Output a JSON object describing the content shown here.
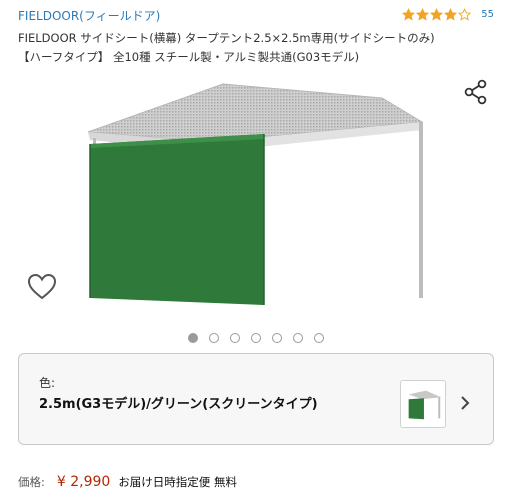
{
  "product": {
    "brand": "FIELDOOR(フィールドア)",
    "rating_stars": 4,
    "rating_count": "55",
    "title_line1": "FIELDOOR サイドシート(横幕) タープテント2.5×2.5m専用(サイドシートのみ)",
    "title_line2": "【ハーフタイプ】 全10種 スチール製・アルミ製共通(G03モデル)"
  },
  "gallery": {
    "image_count": 7,
    "active_index": 0
  },
  "variant": {
    "label": "色:",
    "value": "2.5m(G3モデル)/グリーン(スクリーンタイプ)"
  },
  "price": {
    "label": "価格:",
    "value": "¥ 2,990",
    "delivery": "お届け日時指定便 無料"
  },
  "colors": {
    "link": "#2a7ab8",
    "star": "#f0a426",
    "price": "#b12704",
    "sheet_green": "#2f7a3a"
  }
}
